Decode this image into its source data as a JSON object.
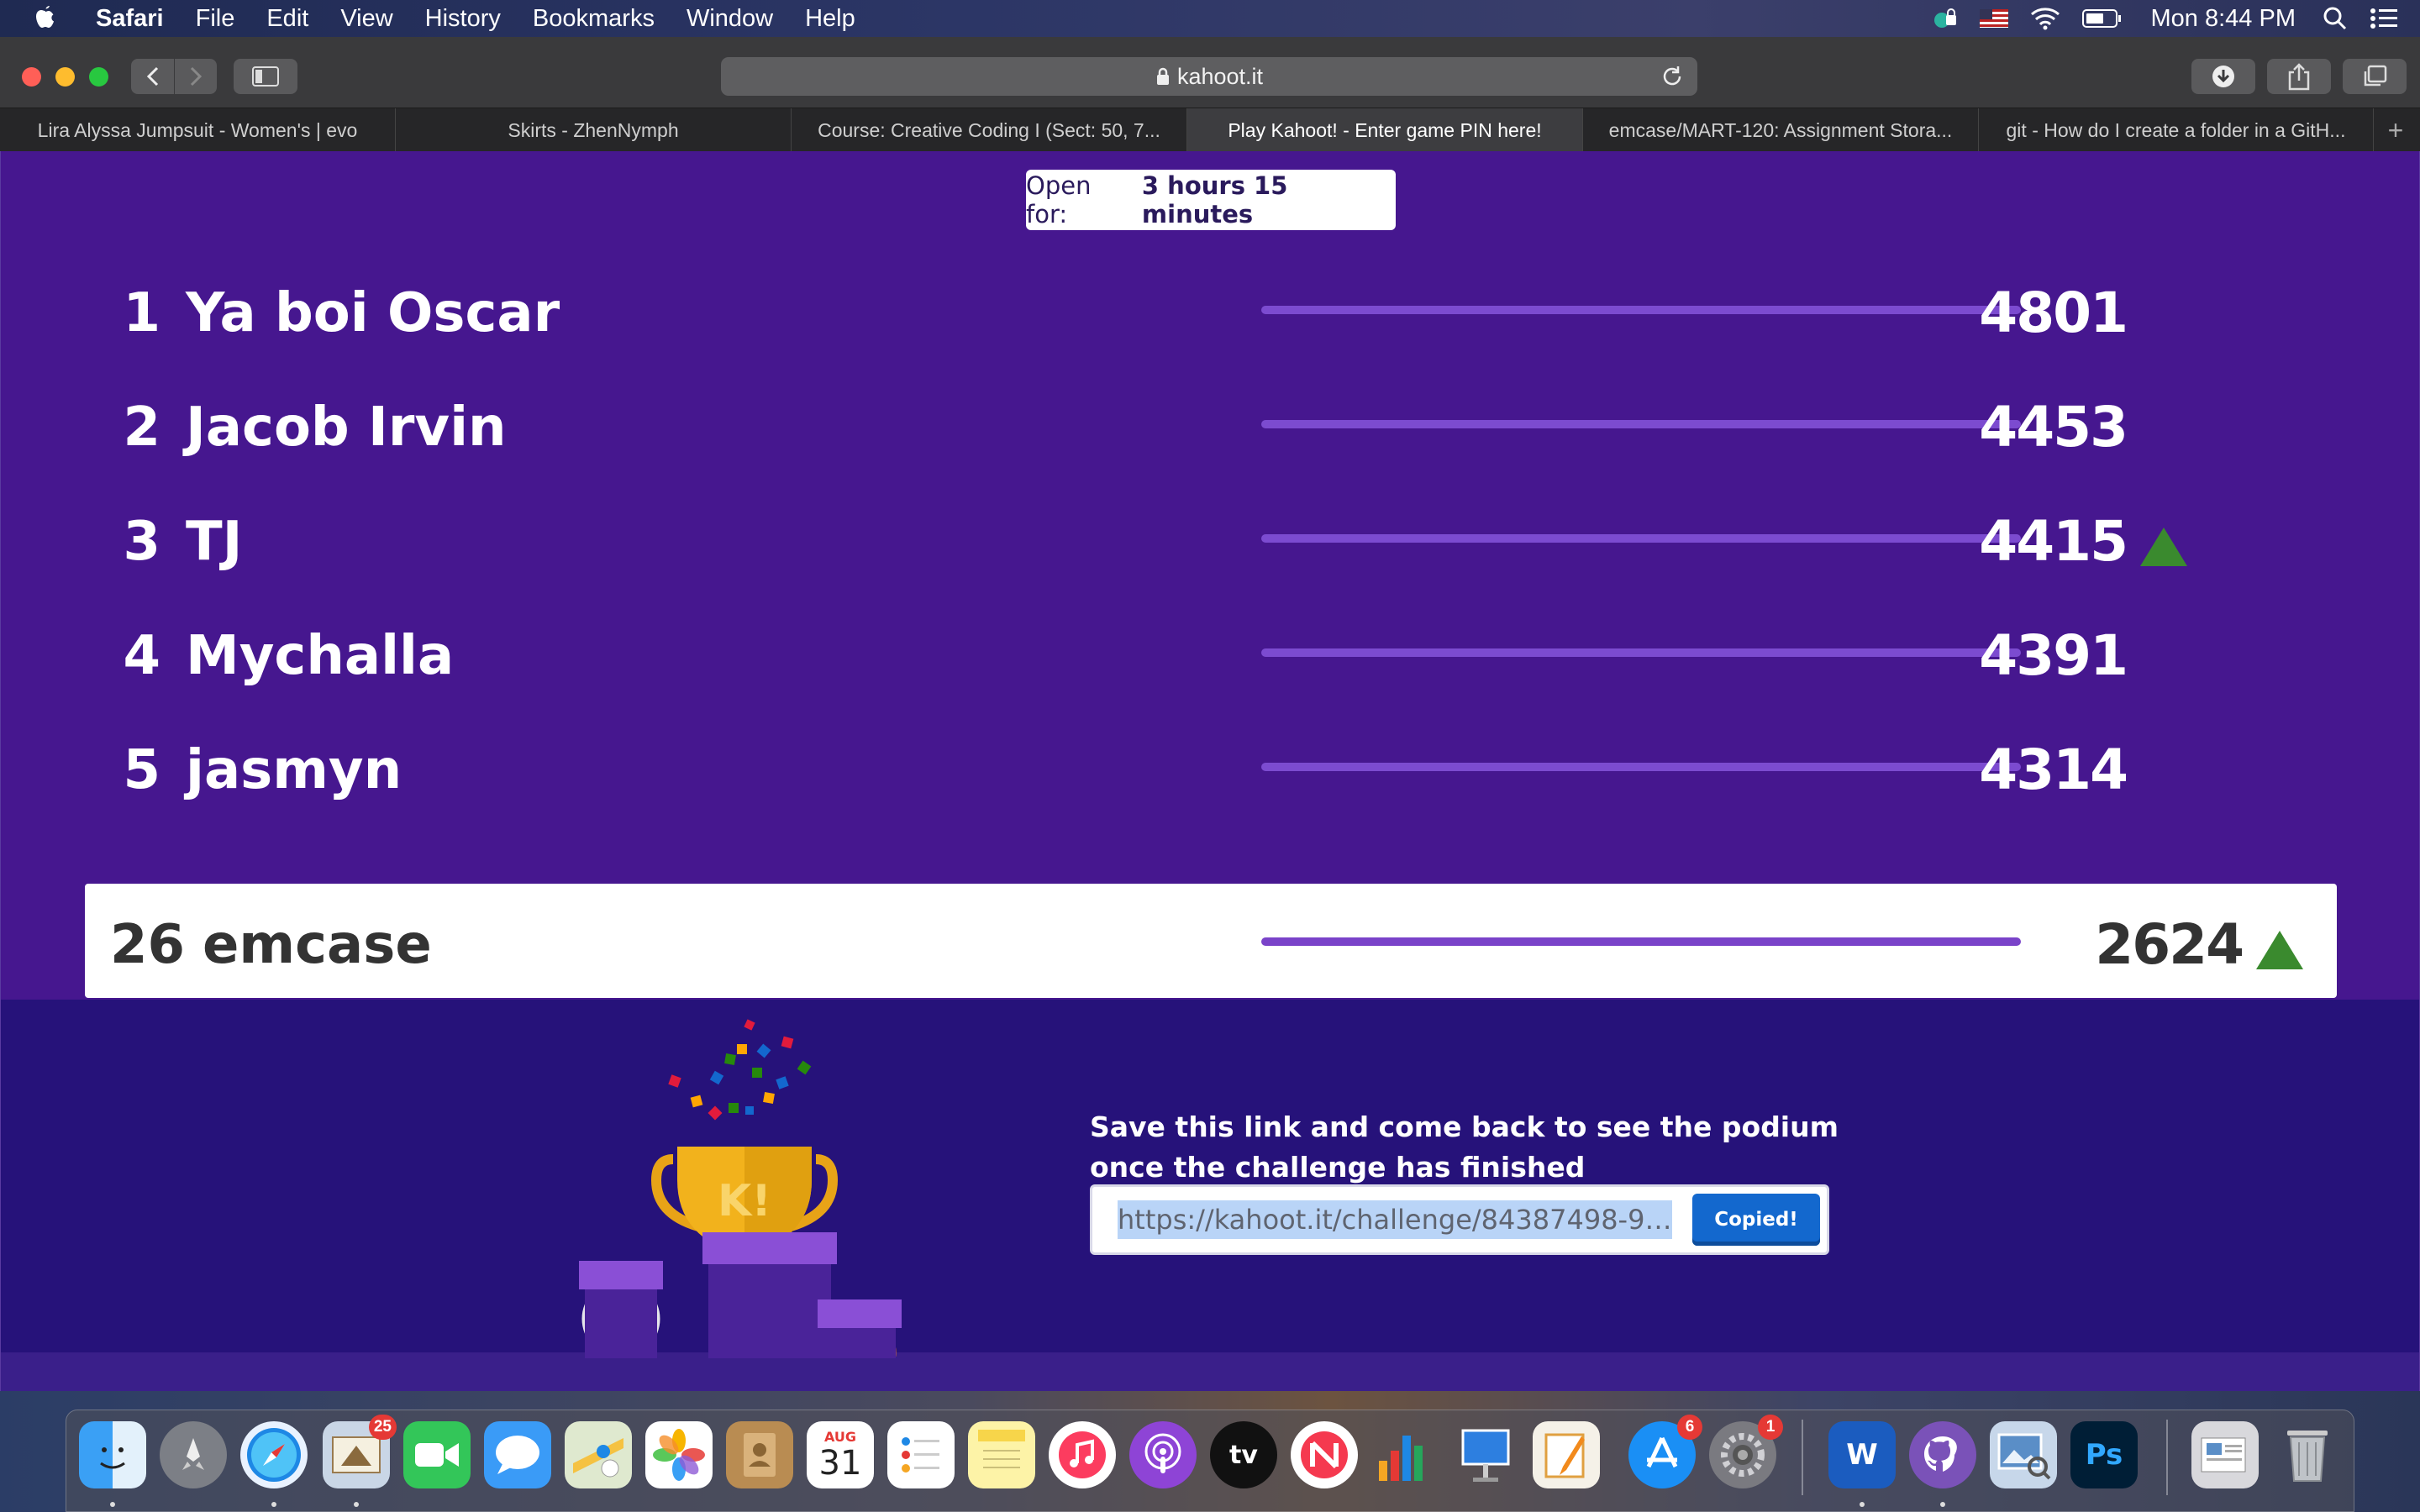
{
  "menubar": {
    "app_name": "Safari",
    "items": [
      "File",
      "Edit",
      "View",
      "History",
      "Bookmarks",
      "Window",
      "Help"
    ],
    "clock": "Mon 8:44 PM"
  },
  "browser": {
    "address": "kahoot.it",
    "tabs": [
      "Lira Alyssa Jumpsuit - Women's | evo",
      "Skirts - ZhenNymph",
      "Course: Creative Coding I (Sect: 50, 7...",
      "Play Kahoot! - Enter game PIN here!",
      "emcase/MART-120: Assignment Stora...",
      "git - How do I create a folder in a GitH..."
    ],
    "active_tab": 3,
    "new_tab": "+"
  },
  "page": {
    "open_for_label": "Open for:",
    "open_for_value": "3 hours 15 minutes",
    "leaderboard": [
      {
        "rank": "1",
        "name": "Ya boi Oscar",
        "score": "4801",
        "up": false
      },
      {
        "rank": "2",
        "name": "Jacob Irvin",
        "score": "4453",
        "up": false
      },
      {
        "rank": "3",
        "name": "TJ",
        "score": "4415",
        "up": true
      },
      {
        "rank": "4",
        "name": "Mychalla",
        "score": "4391",
        "up": false
      },
      {
        "rank": "5",
        "name": "jasmyn",
        "score": "4314",
        "up": false
      }
    ],
    "me": {
      "rank": "26",
      "name": "emcase",
      "score": "2624",
      "up": true
    },
    "save_line1": "Save this link and come back to see the podium",
    "save_line2": "once the challenge has finished",
    "link": "https://kahoot.it/challenge/84387498-97...",
    "copy_label": "Copied!",
    "trophy_letter": "K!"
  },
  "dock": {
    "mail_badge": "25",
    "calendar_month": "AUG",
    "calendar_day": "31",
    "appstore_badge": "6",
    "prefs_badge": "1",
    "tv_label": "tv",
    "word_label": "W",
    "ps_label": "Ps"
  },
  "colors": {
    "kahoot_purple": "#46178f",
    "footer_purple": "#26127a",
    "up_arrow": "#3a8a2e",
    "copy_button": "#1368ce"
  }
}
